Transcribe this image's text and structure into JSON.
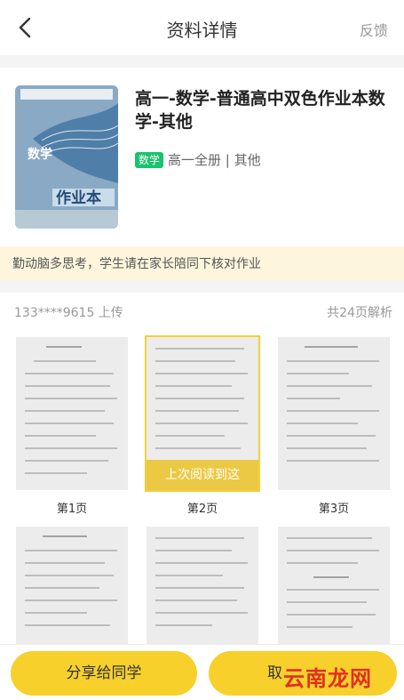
{
  "header": {
    "title": "资料详情",
    "feedback": "反馈"
  },
  "book": {
    "cover_subject": "数学",
    "cover_name": "作业本",
    "title": "高一-数学-普通高中双色作业本数学-其他",
    "subject_badge": "数学",
    "meta": "高一全册 | 其他"
  },
  "notice": "勤动脑多思考，学生请在家长陪同下核对作业",
  "uploader": "133****9615  上传",
  "page_count": "共24页解析",
  "last_read_label": "上次阅读到这",
  "pages": [
    {
      "label": "第1页"
    },
    {
      "label": "第2页"
    },
    {
      "label": "第3页"
    },
    {
      "label": ""
    },
    {
      "label": ""
    },
    {
      "label": ""
    }
  ],
  "buttons": {
    "share": "分享给同学",
    "other": "取"
  },
  "watermark": "云南龙网",
  "colors": {
    "accent": "#f8d02c",
    "badge": "#19c26b",
    "notice_bg": "#fdf6dd"
  }
}
